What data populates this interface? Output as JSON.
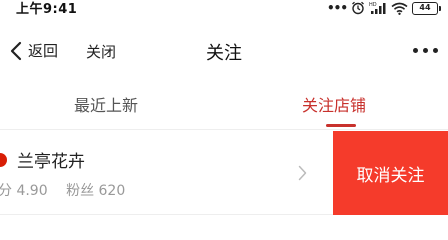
{
  "status_bar": {
    "time": "上午9:41",
    "dots": "•••",
    "battery": "44",
    "icons": [
      "alarm-icon",
      "signal-icon",
      "wifi-icon",
      "battery-icon"
    ]
  },
  "nav": {
    "back_label": "返回",
    "close_label": "关闭",
    "title": "关注",
    "more_icon": "more-icon"
  },
  "tabs": [
    {
      "label": "最近上新",
      "active": false
    },
    {
      "label": "关注店铺",
      "active": true
    }
  ],
  "shop": {
    "name": "兰亭花卉",
    "score": "分 4.90",
    "fans": "粉丝 620",
    "unfollow_label": "取消关注"
  },
  "colors": {
    "accent": "#c8312c",
    "unfollow_bg": "#f53b2b",
    "shop_dot": "#d81e06",
    "muted_text": "#999999"
  }
}
